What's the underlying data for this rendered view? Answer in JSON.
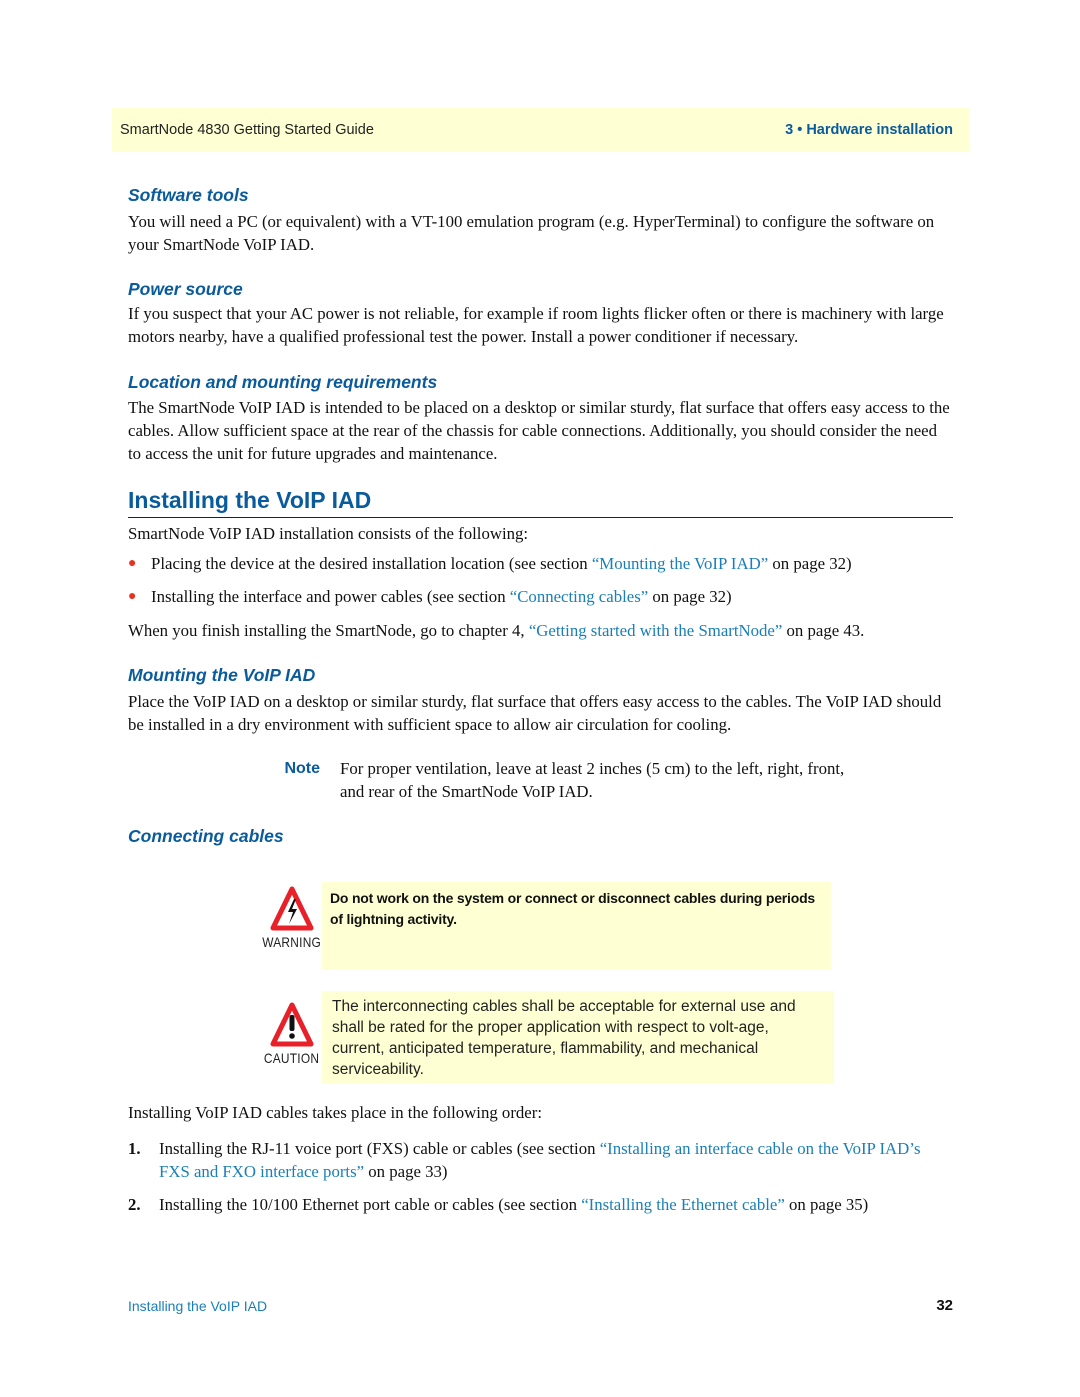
{
  "header": {
    "guide_title": "SmartNode 4830 Getting Started Guide",
    "chapter": "3 • Hardware installation"
  },
  "sections": {
    "software_tools": {
      "heading": "Software tools",
      "body": "You will need a PC (or equivalent) with a VT-100 emulation program (e.g. HyperTerminal) to configure the software on your SmartNode VoIP IAD."
    },
    "power_source": {
      "heading": "Power source",
      "body": "If you suspect that your AC power is not reliable, for example if room lights flicker often or there is machinery with large motors nearby, have a qualified professional test the power. Install a power conditioner if necessary."
    },
    "location": {
      "heading": "Location and mounting requirements",
      "body": "The SmartNode VoIP IAD is intended to be placed on a desktop or similar sturdy, flat surface that offers easy access to the cables. Allow sufficient space at the rear of the chassis for cable connections. Additionally, you should consider the need to access the unit for future upgrades and maintenance."
    },
    "installing": {
      "heading": "Installing the VoIP IAD",
      "intro": "SmartNode VoIP IAD installation consists of the following:",
      "bullets": [
        {
          "pre": "Placing the device at the desired installation location (see section ",
          "link": "“Mounting the VoIP IAD”",
          "post": " on page 32)"
        },
        {
          "pre": "Installing the interface and power cables (see section ",
          "link": "“Connecting cables”",
          "post": " on page 32)"
        }
      ],
      "finish": {
        "pre": "When you finish installing the SmartNode, go to chapter 4, ",
        "link": "“Getting started with the SmartNode”",
        "post": " on page 43."
      }
    },
    "mounting": {
      "heading": "Mounting the VoIP IAD",
      "body": "Place the VoIP IAD on a desktop or similar sturdy, flat surface that offers easy access to the cables. The VoIP IAD should be installed in a dry environment with sufficient space to allow air circulation for cooling.",
      "note_label": "Note",
      "note_text": "For proper ventilation, leave at least 2 inches (5 cm) to the left, right, front, and rear of the SmartNode VoIP IAD."
    },
    "connecting": {
      "heading": "Connecting cables",
      "warning_label": "WARNING",
      "warning_icon": "lightning-warning-icon",
      "warning_text": "Do not work on the system or connect or disconnect cables during periods of lightning activity.",
      "caution_label": "CAUTION",
      "caution_icon": "exclamation-caution-icon",
      "caution_text": "The interconnecting cables shall be acceptable for external use and shall be rated for the proper application with respect to volt-age, current, anticipated temperature, flammability, and mechanical serviceability.",
      "order_intro": "Installing VoIP IAD cables takes place in the following order:",
      "steps": [
        {
          "num": "1.",
          "pre": "Installing the RJ-11 voice port (FXS) cable or cables (see section ",
          "link": "“Installing an interface cable on the VoIP IAD’s FXS and FXO interface ports”",
          "post": " on page 33)"
        },
        {
          "num": "2.",
          "pre": "Installing the 10/100 Ethernet port cable or cables (see section ",
          "link": "“Installing the Ethernet cable”",
          "post": " on page 35)"
        }
      ]
    }
  },
  "footer": {
    "section_title": "Installing the VoIP IAD",
    "page_number": "32"
  },
  "colors": {
    "heading_blue": "#0a5b9c",
    "link_blue": "#1a7fb8",
    "banner_yellow": "#ffffd4",
    "bullet_red": "#e63222",
    "icon_red": "#e8202a"
  }
}
